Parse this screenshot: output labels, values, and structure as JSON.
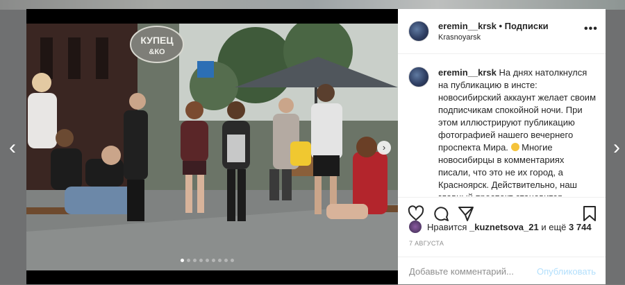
{
  "nav": {
    "prev_icon": "chevron-left-icon",
    "next_icon": "chevron-right-icon"
  },
  "photo": {
    "sign_line1": "КУПЕЦ",
    "sign_line2": "&КО",
    "next_icon": "chevron-right-icon",
    "dots_total": 9,
    "dots_active": 1
  },
  "post": {
    "username": "eremin__krsk",
    "separator": "•",
    "follow_label": "Подписки",
    "location": "Krasnoyarsk",
    "more_icon": "ellipsis-icon",
    "caption_before_emoji": "На днях натолкнулся на публикацию в инсте: новосибирский аккаунт желает своим подписчикам спокойной ночи. При этом иллюстрируют публикацию фотографией нашего вечернего проспекта Мира.",
    "caption_after_emoji": "Многие новосибирцы в комментариях писали, что это не их город, а Красноярск. Действительно, наш главный проспект становится",
    "likes_prefix": "Нравится",
    "likes_user": "_kuznetsova_21",
    "likes_middle": "и ещё",
    "likes_count": "3 744",
    "date": "7 АВГУСТА"
  },
  "comment": {
    "placeholder": "Добавьте комментарий...",
    "publish_label": "Опубликовать"
  },
  "colors": {
    "link": "#b2dffc",
    "text": "#262626",
    "muted": "#8e8e8e"
  }
}
